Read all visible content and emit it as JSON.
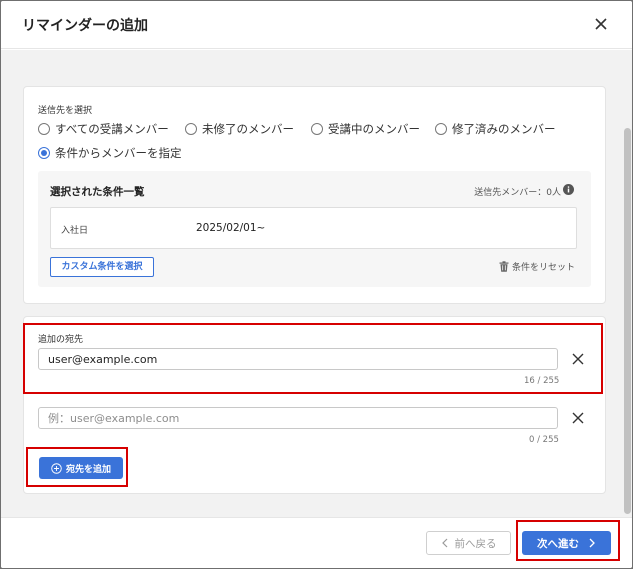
{
  "modal": {
    "title": "リマインダーの追加"
  },
  "recipients": {
    "section_label": "送信先を選択",
    "options": [
      {
        "label": "すべての受講メンバー",
        "checked": false
      },
      {
        "label": "未修了のメンバー",
        "checked": false
      },
      {
        "label": "受講中のメンバー",
        "checked": false
      },
      {
        "label": "修了済みのメンバー",
        "checked": false
      },
      {
        "label": "条件からメンバーを指定",
        "checked": true
      }
    ]
  },
  "conditions": {
    "title": "選択された条件一覧",
    "recipient_count": "送信先メンバー：0人",
    "rows": [
      {
        "key": "入社日",
        "value": "2025/02/01~"
      }
    ],
    "custom_button": "カスタム条件を選択",
    "reset_label": "条件をリセット"
  },
  "extra_recipients": {
    "section_label": "追加の宛先",
    "inputs": [
      {
        "value": "user@example.com",
        "placeholder": "",
        "counter": "16 / 255"
      },
      {
        "value": "",
        "placeholder": "例：user@example.com",
        "counter": "0 / 255"
      }
    ],
    "add_button": "宛先を追加"
  },
  "footer": {
    "prev_label": "前へ戻る",
    "next_label": "次へ進む"
  },
  "colors": {
    "accent": "#3a73d9",
    "highlight": "#d60000"
  },
  "icons": [
    "close-icon",
    "info-icon",
    "trash-icon",
    "plus-circle-icon",
    "chevron-left-icon",
    "chevron-right-icon"
  ]
}
